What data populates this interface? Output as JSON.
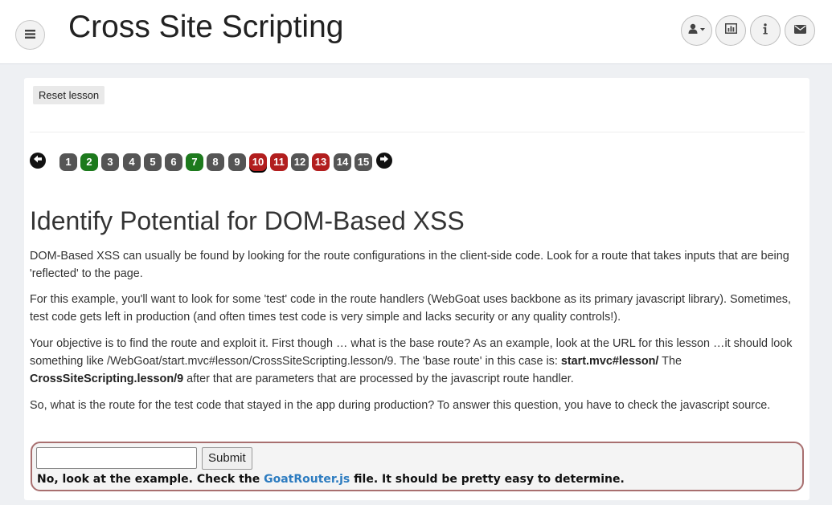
{
  "header": {
    "title": "Cross Site Scripting"
  },
  "toolbar": {
    "reset_label": "Reset lesson"
  },
  "pagination": {
    "pages": [
      {
        "label": "1",
        "status": "gray"
      },
      {
        "label": "2",
        "status": "green"
      },
      {
        "label": "3",
        "status": "gray"
      },
      {
        "label": "4",
        "status": "gray"
      },
      {
        "label": "5",
        "status": "gray"
      },
      {
        "label": "6",
        "status": "gray"
      },
      {
        "label": "7",
        "status": "green"
      },
      {
        "label": "8",
        "status": "gray"
      },
      {
        "label": "9",
        "status": "gray"
      },
      {
        "label": "10",
        "status": "red",
        "current": true
      },
      {
        "label": "11",
        "status": "red"
      },
      {
        "label": "12",
        "status": "gray"
      },
      {
        "label": "13",
        "status": "red"
      },
      {
        "label": "14",
        "status": "gray"
      },
      {
        "label": "15",
        "status": "gray"
      }
    ]
  },
  "lesson": {
    "heading": "Identify Potential for DOM-Based XSS",
    "p1": "DOM-Based XSS can usually be found by looking for the route configurations in the client-side code. Look for a route that takes inputs that are being 'reflected' to the page.",
    "p2": "For this example, you'll want to look for some 'test' code in the route handlers (WebGoat uses backbone as its primary javascript library). Sometimes, test code gets left in production (and often times test code is very simple and lacks security or any quality controls!).",
    "p3_a": "Your objective is to find the route and exploit it. First though … what is the base route? As an example, look at the URL for this lesson …it should look something like /WebGoat/start.mvc#lesson/CrossSiteScripting.lesson/9. The 'base route' in this case is: ",
    "p3_b1": "start.mvc#lesson/",
    "p3_c": " The ",
    "p3_b2": "CrossSiteScripting.lesson/9",
    "p3_d": " after that are parameters that are processed by the javascript route handler.",
    "p4": "So, what is the route for the test code that stayed in the app during production? To answer this question, you have to check the javascript source."
  },
  "attack": {
    "input_value": "",
    "submit_label": "Submit",
    "feedback_pre": "No, look at the example. Check the ",
    "feedback_link": "GoatRouter.js",
    "feedback_post": " file. It should be pretty easy to determine."
  },
  "colors": {
    "green": "#1d7a1d",
    "red": "#b21e1e",
    "gray": "#555555",
    "link": "#2d7cc0"
  },
  "icons": {
    "menu": "hamburger-icon",
    "user": "user-icon",
    "report": "bar-chart-icon",
    "info": "info-icon",
    "mail": "envelope-icon",
    "prev": "arrow-left-icon",
    "next": "arrow-right-icon"
  }
}
